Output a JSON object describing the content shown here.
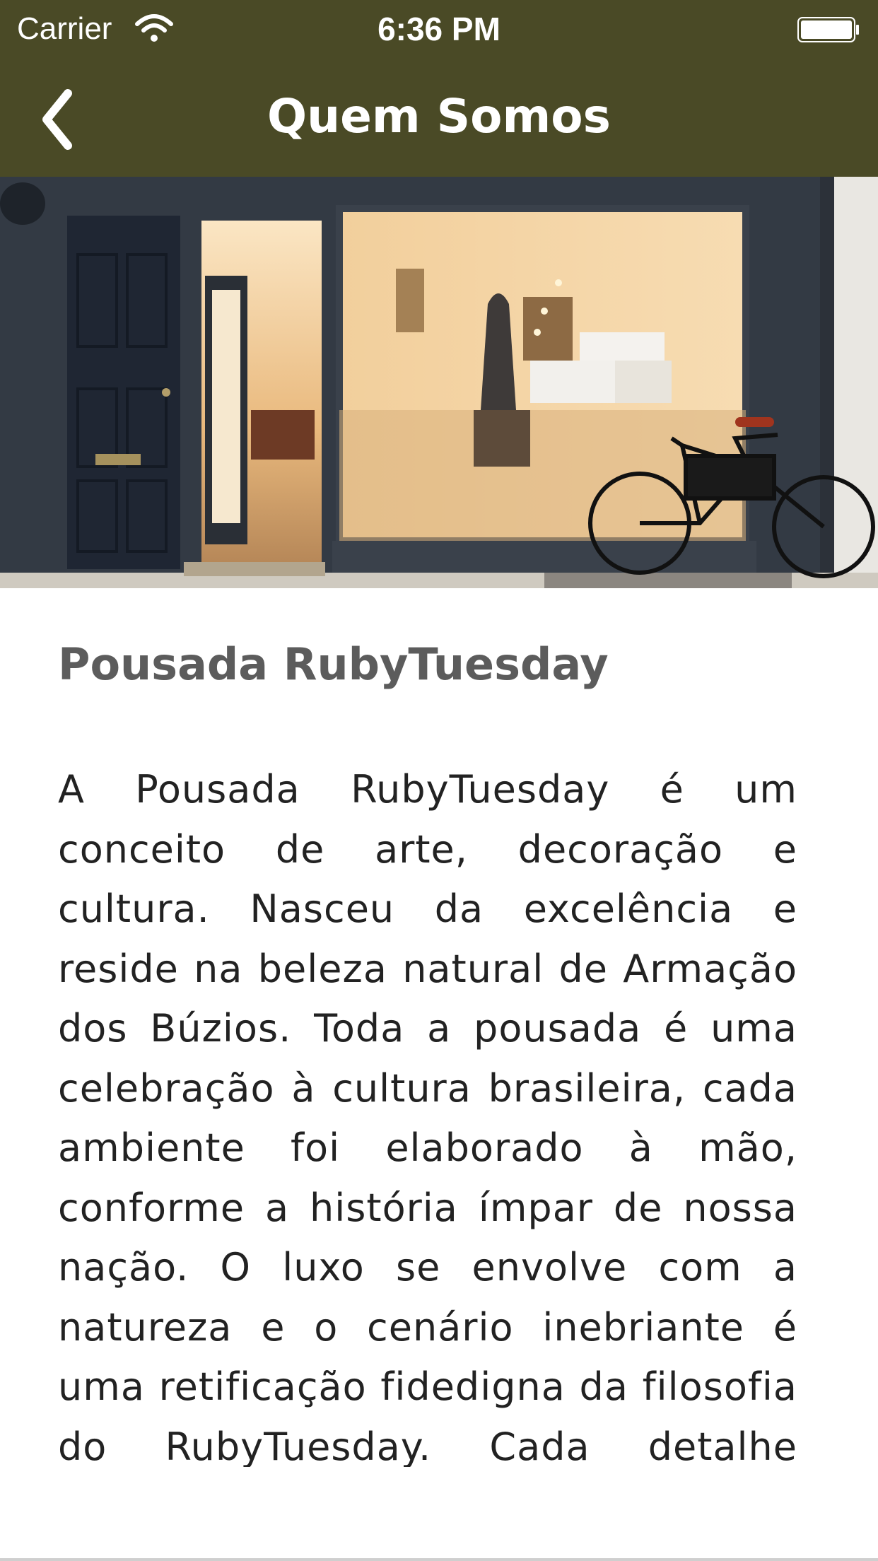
{
  "status_bar": {
    "carrier": "Carrier",
    "time": "6:36 PM"
  },
  "navbar": {
    "title": "Quem Somos",
    "back_icon": "chevron-left-icon",
    "background_color": "#4a4a26"
  },
  "hero_image": {
    "description_icon": "storefront-photo"
  },
  "content": {
    "heading": "Pousada RubyTuesday",
    "body": "A Pousada RubyTuesday é um conceito de arte, decoração e cultura. Nasceu da excelência e reside na beleza natural de Armação dos Búzios. Toda a pousada é uma celebração à cultura brasileira, cada ambiente foi elaborado à mão, conforme a história ímpar de nossa nação. O luxo se envolve com a natureza e o cenário inebriante é uma retificação fidedigna da filosofia do RubyTuesday. Cada detalhe engloba nossa esfera. O"
  }
}
